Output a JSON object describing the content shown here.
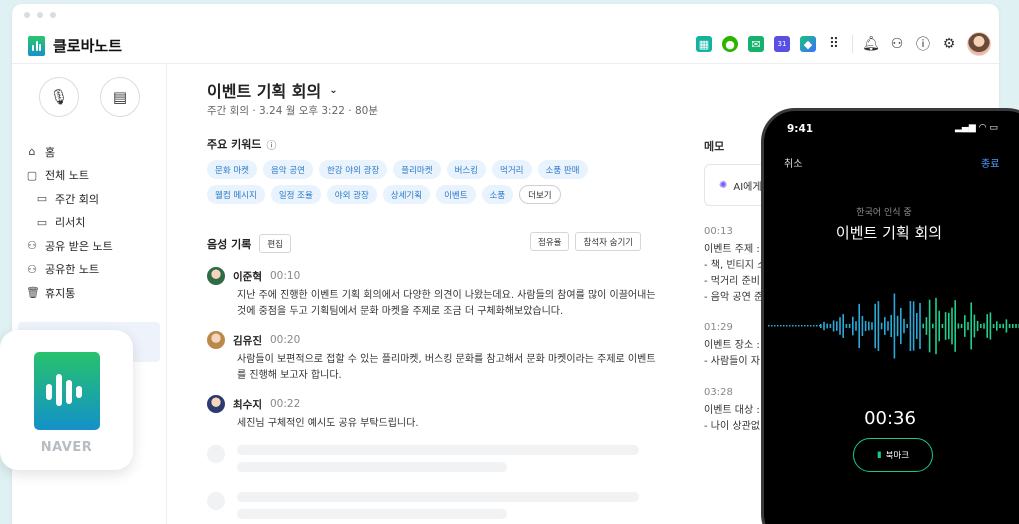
{
  "app": {
    "title": "클로바노트"
  },
  "topbar": {
    "icons": [
      "grid-app-icon",
      "chat-icon",
      "mail-icon",
      "calendar-icon",
      "cube-icon",
      "apps-menu-icon",
      "bell-icon",
      "share-icon",
      "help-icon",
      "settings-icon",
      "avatar"
    ],
    "calendar_day": "31"
  },
  "sidebar": {
    "items": [
      {
        "label": "홈",
        "icon": "⌂"
      },
      {
        "label": "전체 노트",
        "icon": "▢"
      },
      {
        "label": "주간 회의",
        "icon": "▭",
        "sub": true
      },
      {
        "label": "리서치",
        "icon": "▭",
        "sub": true
      },
      {
        "label": "공유 받은 노트",
        "icon": "⚇"
      },
      {
        "label": "공유한 노트",
        "icon": "⚇"
      },
      {
        "label": "휴지통",
        "icon": "🗑"
      }
    ]
  },
  "note": {
    "title": "이벤트 기획 회의",
    "meta": "주간 회의 · 3.24 월 오후 3:22 · 80분",
    "keywords_label": "주요 키워드",
    "keywords": [
      "문화 마켓",
      "음악 공연",
      "한강 야외 광장",
      "플리마켓",
      "버스킹",
      "먹거리",
      "소품 판매",
      "웰컴 메시지",
      "일정 조율",
      "야외 광장",
      "상세기획",
      "이벤트",
      "소품"
    ],
    "more_label": "더보기",
    "recording_label": "음성 기록",
    "edit_label": "편집",
    "share_rate_label": "점유율",
    "hide_participants_label": "참석자 숨기기",
    "utterances": [
      {
        "speaker": "이준혁",
        "time": "00:10",
        "text": "지난 주에 진행한 이벤트 기획 회의에서 다양한 의견이 나왔는데요. 사람들의 참여를 많이 이끌어내는 것에 중점을 두고 기획팀에서 문화 마켓을 주제로 조금 더 구체화해보았습니다."
      },
      {
        "speaker": "김유진",
        "time": "00:20",
        "text": "사람들이 보편적으로 접할 수 있는 플리마켓, 버스킹 문화를 참고해서 문화 마켓이라는 주제로 이벤트를 진행해 보고자 합니다."
      },
      {
        "speaker": "최수지",
        "time": "00:22",
        "text": "세진님 구체적인 예시도 공유 부탁드립니다."
      }
    ]
  },
  "memo": {
    "title": "메모",
    "ai_label": "AI에게",
    "blocks": [
      {
        "time": "00:13",
        "lines": [
          "이벤트 주제 :",
          "- 책, 빈티지 소",
          "- 먹거리 준비",
          "- 음악 공연 준"
        ]
      },
      {
        "time": "01:29",
        "lines": [
          "이벤트 장소 :",
          "- 사람들이 자"
        ]
      },
      {
        "time": "03:28",
        "lines": [
          "이벤트 대상 :",
          "- 나이 상관없"
        ]
      }
    ]
  },
  "badge": {
    "brand": "NAVER"
  },
  "phone": {
    "time": "9:41",
    "cancel": "취소",
    "done": "종료",
    "status": "한국어 인식 중",
    "title": "이벤트 기획 회의",
    "timer": "00:36",
    "bookmark": "북마크"
  }
}
